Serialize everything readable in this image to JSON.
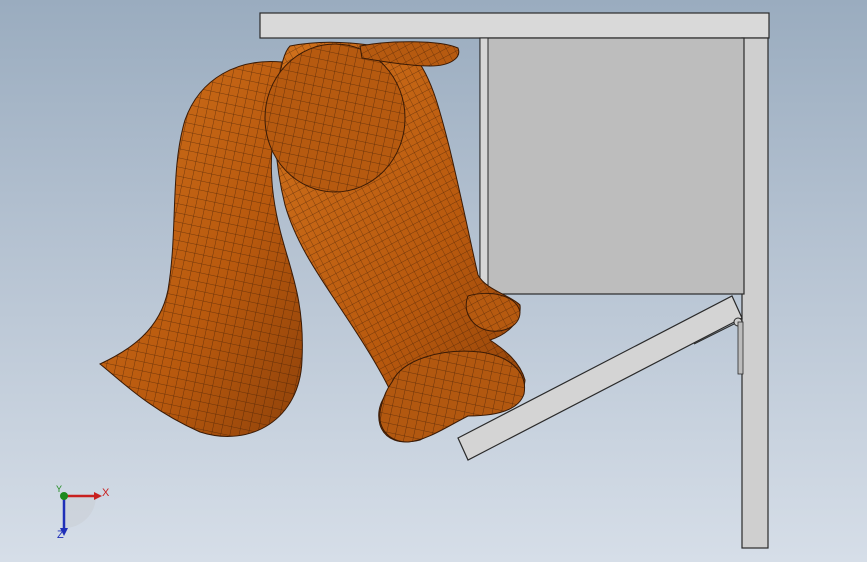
{
  "viewport": {
    "background_top": "#9aacbf",
    "background_bottom": "#d6dee8"
  },
  "model": {
    "body_color": "#c0600f",
    "mesh_color": "#3a1a05",
    "panel_color": "#bdbdbd",
    "frame_color": "#d9d9d9",
    "edge_color": "#2a2a2a"
  },
  "triad": {
    "x_label": "X",
    "y_label": "Y",
    "z_label": "Z",
    "x_color": "#c8201f",
    "y_color": "#1d8a1d",
    "z_color": "#1f2fb8"
  }
}
